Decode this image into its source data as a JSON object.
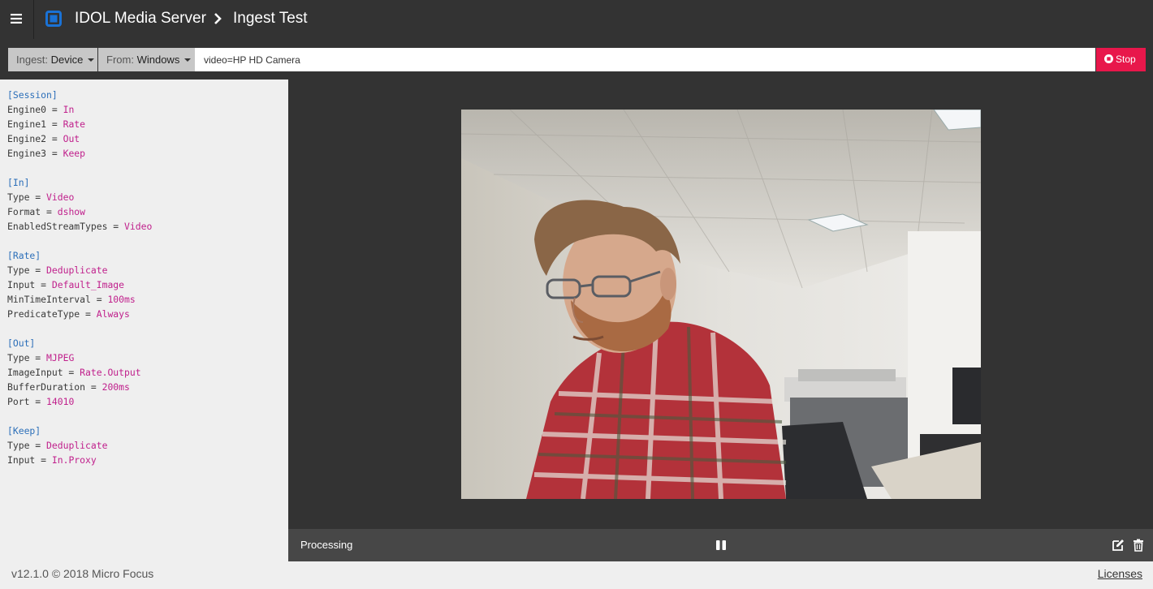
{
  "header": {
    "app_title": "IDOL Media Server",
    "page_title": "Ingest Test",
    "logo_color": "#1a72d6"
  },
  "toolbar": {
    "ingest_label": "Ingest:",
    "ingest_value": "Device",
    "from_label": "From:",
    "from_value": "Windows",
    "source_value": "video=HP HD Camera",
    "stop_label": "Stop",
    "stop_color": "#e8174b"
  },
  "config": {
    "lines": [
      {
        "section": "[Session]"
      },
      {
        "key": "Engine0",
        "value": "In"
      },
      {
        "key": "Engine1",
        "value": "Rate"
      },
      {
        "key": "Engine2",
        "value": "Out"
      },
      {
        "key": "Engine3",
        "value": "Keep"
      },
      {},
      {
        "section": "[In]"
      },
      {
        "key": "Type",
        "value": "Video"
      },
      {
        "key": "Format",
        "value": "dshow"
      },
      {
        "key": "EnabledStreamTypes",
        "value": "Video"
      },
      {},
      {
        "section": "[Rate]"
      },
      {
        "key": "Type",
        "value": "Deduplicate"
      },
      {
        "key": "Input",
        "value": "Default_Image"
      },
      {
        "key": "MinTimeInterval",
        "value": "100ms"
      },
      {
        "key": "PredicateType",
        "value": "Always"
      },
      {},
      {
        "section": "[Out]"
      },
      {
        "key": "Type",
        "value": "MJPEG"
      },
      {
        "key": "ImageInput",
        "value": "Rate.Output"
      },
      {
        "key": "BufferDuration",
        "value": "200ms"
      },
      {
        "key": "Port",
        "value": "14010"
      },
      {},
      {
        "section": "[Keep]"
      },
      {
        "key": "Type",
        "value": "Deduplicate"
      },
      {
        "key": "Input",
        "value": "In.Proxy"
      }
    ]
  },
  "player": {
    "status_text": "Processing"
  },
  "footer": {
    "version_text": "v12.1.0 © 2018 Micro Focus",
    "licenses_label": "Licenses"
  }
}
